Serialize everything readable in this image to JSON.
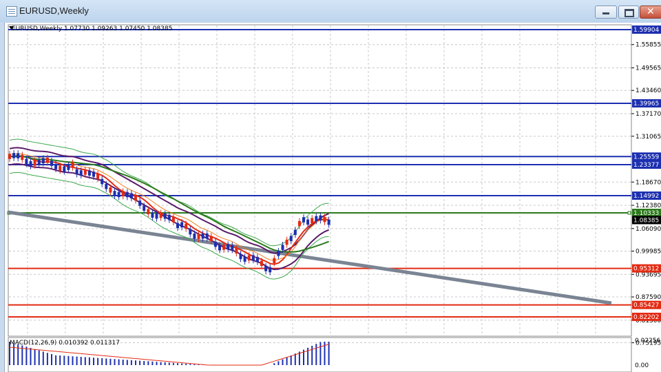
{
  "window": {
    "title": "EURUSD,Weekly",
    "minimize_icon": "minimize-icon",
    "maximize_icon": "maximize-icon",
    "close_icon": "close-icon"
  },
  "chart": {
    "header": "EURUSD,Weekly  1.07730 1.09263 1.07450 1.08385",
    "price_ticks": [
      "1.55855",
      "1.49565",
      "1.43460",
      "1.37170",
      "1.31065",
      "1.18670",
      "1.12380",
      "1.06090",
      "0.99985",
      "0.93695",
      "0.87590",
      "0.81300",
      "0.75195"
    ],
    "level_labels": [
      {
        "text": "1.59904",
        "color": "#1c2fb0"
      },
      {
        "text": "1.39965",
        "color": "#1c2fb0"
      },
      {
        "text": "1.25559",
        "color": "#1c2fb0"
      },
      {
        "text": "1.23377",
        "color": "#1c2fb0"
      },
      {
        "text": "1.14992",
        "color": "#1c2fb0"
      },
      {
        "text": "1.10333",
        "color": "#2a7a1a"
      },
      {
        "text": "1.08385",
        "color": "#000000"
      },
      {
        "text": "0.95312",
        "color": "#e32a12"
      },
      {
        "text": "0.85427",
        "color": "#e32a12"
      },
      {
        "text": "0.82202",
        "color": "#e32a12"
      }
    ]
  },
  "macd": {
    "label": "MACD(12,26,9) 0.010392 0.011317",
    "ticks": [
      "0.022568",
      "0.00"
    ]
  }
}
